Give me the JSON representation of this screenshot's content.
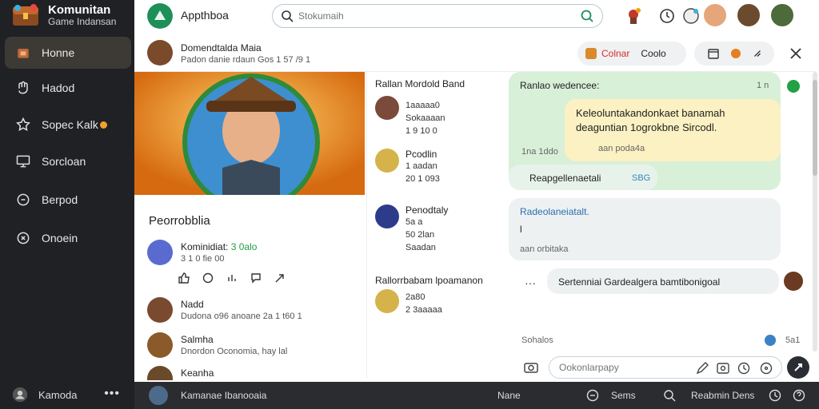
{
  "sidebar": {
    "brand_name": "Komunitan",
    "brand_sub": "Game Indansan",
    "items": [
      {
        "label": "Honne",
        "icon": "home-icon",
        "active": true
      },
      {
        "label": "Hadod",
        "icon": "hand-icon"
      },
      {
        "label": "Sopec Kalk",
        "icon": "star-icon"
      },
      {
        "label": "Sorcloan",
        "icon": "monitor-icon"
      },
      {
        "label": "Berpod",
        "icon": "chat-icon"
      },
      {
        "label": "Onoein",
        "icon": "x-circle-icon"
      }
    ],
    "bottom_label": "Kamoda",
    "bottom_more": "•••"
  },
  "topbar": {
    "app_title": "Appthboa",
    "search_placeholder": "Stokumaih",
    "accent": "#1e8e5a"
  },
  "conversation": {
    "title": "Domendtalda Maia",
    "subtitle": "Padon danie rdaun  Gos  1 57  /9     1",
    "pill_label": "Colnar",
    "pill_value": "Coolo",
    "close_icon": "close-icon"
  },
  "profile": {
    "name": "Peorrobblia",
    "feed": [
      {
        "title": "Kominidiat:",
        "title_green": "3 0alo",
        "sub": "3 1 0  fie  00"
      },
      {
        "title": "Nadd",
        "sub": "Dudona  o96  anoane  2a 1 t60 1"
      },
      {
        "title": "Salmha",
        "sub": "Dnordon Oconomia, hay lal"
      },
      {
        "title": "Keanha",
        "sub": ""
      }
    ]
  },
  "middle": [
    {
      "head": "Rallan Mordold Band",
      "line1": "1aaaaa0",
      "line2": "Sokaaaan",
      "line3": "1 9 10 0"
    },
    {
      "head": "Pcodlin",
      "line1": "1 aadan",
      "line2": "20  1 093"
    },
    {
      "head": "Penodtaly",
      "line1": "5a a",
      "line2": "50 2lan",
      "line3": "Saadan"
    },
    {
      "head": "Rallorrbabam lpoamanon",
      "line1": "2a80",
      "line2": "2 3aaaaa"
    }
  ],
  "chat": {
    "msg1_head": "Ranlao wedencee:",
    "msg1_time": "1 n",
    "msg2_line1": "Keleoluntakandonkaet banamah",
    "msg2_line2": "deaguntian 1ogrokbne  Sircodl.",
    "msg2_time": "1na 1ddo",
    "msg2_note": "aan  poda4a",
    "msg3": "Reapgellenaetali",
    "msg3_tag": "SBG",
    "msg4_head": "Radeolaneiatalt.",
    "msg4_line": "l",
    "msg4_note": "aan   orbitaka",
    "msg5": "Sertenniai Gardealgera bamtibonigoal",
    "msg5_more": "···",
    "footer_left": "Sohalos",
    "footer_right": "5a1",
    "composer_placeholder": "Ookonlarpapy"
  },
  "bottombar": {
    "left": "Kamanae  Ibanooaia",
    "mid": "Nane",
    "item2": "Sems",
    "item3": "Reabmin Dens"
  }
}
